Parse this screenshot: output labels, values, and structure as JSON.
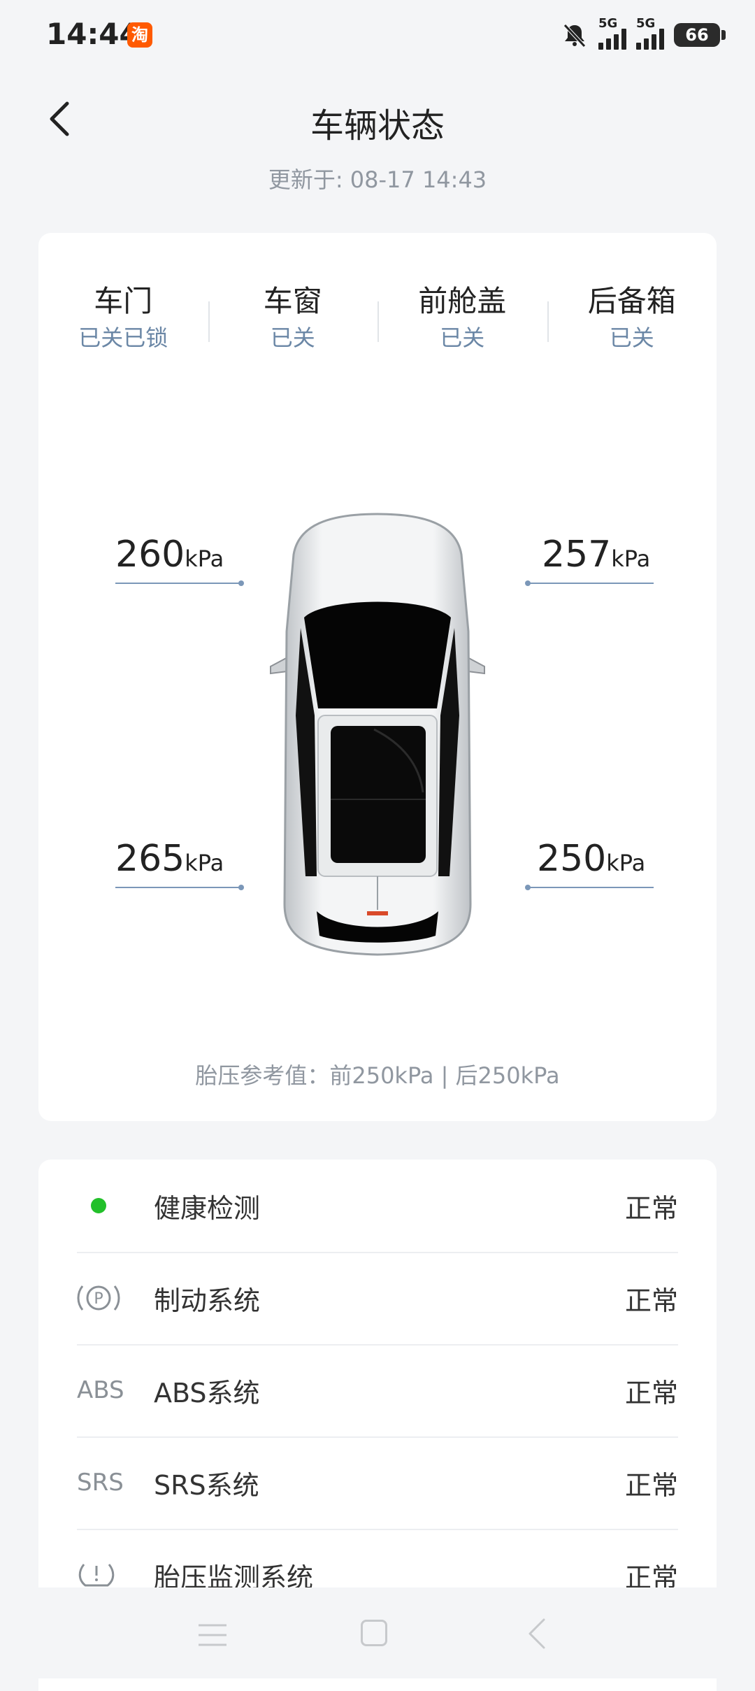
{
  "status_bar": {
    "time": "14:44",
    "app_badge": "淘",
    "signal1_label": "5G",
    "signal2_label": "5G",
    "battery": "66"
  },
  "header": {
    "title": "车辆状态",
    "update_time": "更新于: 08-17 14:43"
  },
  "vehicle_status": [
    {
      "name": "车门",
      "value": "已关已锁"
    },
    {
      "name": "车窗",
      "value": "已关"
    },
    {
      "name": "前舱盖",
      "value": "已关"
    },
    {
      "name": "后备箱",
      "value": "已关"
    }
  ],
  "tires": {
    "front_left": "260",
    "front_right": "257",
    "rear_left": "265",
    "rear_right": "250",
    "unit": "kPa"
  },
  "tire_reference": "胎压参考值：前250kPa | 后250kPa",
  "health": [
    {
      "label": "健康检测",
      "value": "正常",
      "icon": "green-dot"
    },
    {
      "label": "制动系统",
      "value": "正常",
      "icon": "parking-brake-icon"
    },
    {
      "label": "ABS系统",
      "value": "正常",
      "icon": "ABS"
    },
    {
      "label": "SRS系统",
      "value": "正常",
      "icon": "SRS"
    },
    {
      "label": "胎压监测系统",
      "value": "正常",
      "icon": "tire-pressure-icon"
    }
  ],
  "colors": {
    "accent_value": "#6b87a6",
    "ok_green": "#22c02a"
  }
}
